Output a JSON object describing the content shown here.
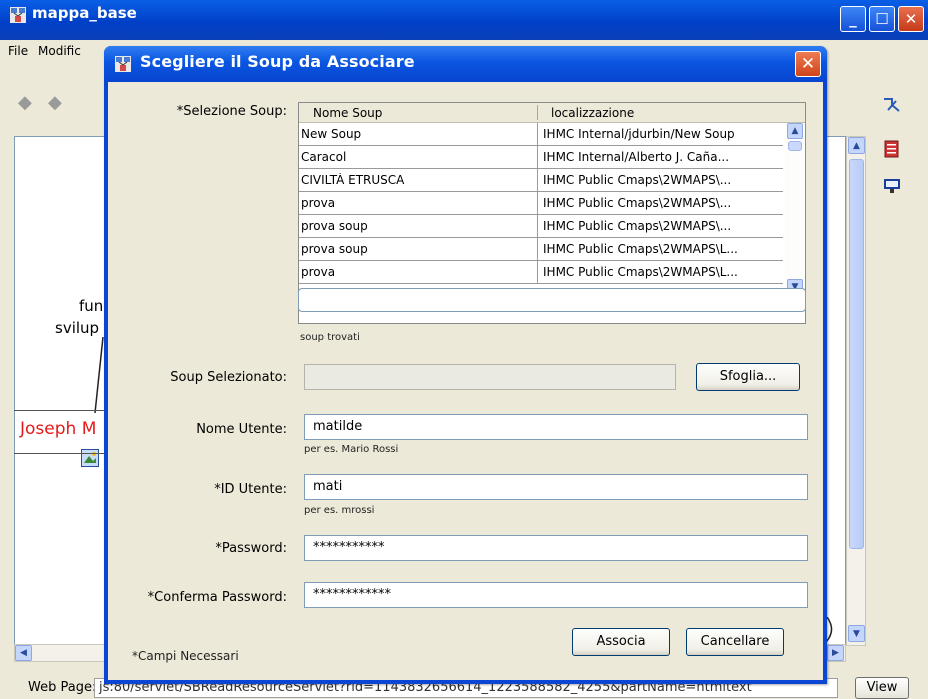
{
  "window": {
    "title": "mappa_base",
    "menu": [
      "File",
      "Modific"
    ]
  },
  "canvas": {
    "fragment1": "fun",
    "fragment2": "svilup",
    "node_text": "Joseph M"
  },
  "status": {
    "label": "Web Page:",
    "url": "js:80/servlet/SBReadResourceServlet?rid=1143832656614_1223588582_4255&partName=htmltext",
    "view_button": "View"
  },
  "dialog": {
    "title": "Scegliere il Soup da Associare",
    "selection_label": "*Selezione Soup:",
    "table": {
      "columns": [
        "Nome Soup",
        "localizzazione"
      ],
      "rows": [
        {
          "name": "New Soup",
          "location": "IHMC Internal/jdurbin/New Soup"
        },
        {
          "name": "Caracol",
          "location": "IHMC Internal/Alberto J. Caña..."
        },
        {
          "name": "CIVILTÀ ETRUSCA",
          "location": "IHMC Public Cmaps\\2WMAPS\\..."
        },
        {
          "name": "prova",
          "location": "IHMC Public Cmaps\\2WMAPS\\..."
        },
        {
          "name": "prova soup",
          "location": "IHMC Public Cmaps\\2WMAPS\\..."
        },
        {
          "name": "prova soup",
          "location": "IHMC Public Cmaps\\2WMAPS\\L..."
        },
        {
          "name": "prova",
          "location": "IHMC Public Cmaps\\2WMAPS\\L..."
        }
      ]
    },
    "filter_value": "",
    "found_hint": "soup trovati",
    "selected_label": "Soup Selezionato:",
    "selected_value": "",
    "browse_button": "Sfoglia...",
    "username_label": "Nome Utente:",
    "username_value": "matilde",
    "username_hint": "per es. Mario Rossi",
    "userid_label": "*ID Utente:",
    "userid_value": "mati",
    "userid_hint": "per es. mrossi",
    "password_label": "*Password:",
    "password_value": "***********",
    "confirm_label": "*Conferma Password:",
    "confirm_value": "************",
    "required_note": "*Campi Necessari",
    "associate_button": "Associa",
    "cancel_button": "Cancellare"
  },
  "colors": {
    "titlebar": "#0a45d4",
    "dialog_bg": "#ece9d8",
    "node_text": "#e41a1a"
  }
}
